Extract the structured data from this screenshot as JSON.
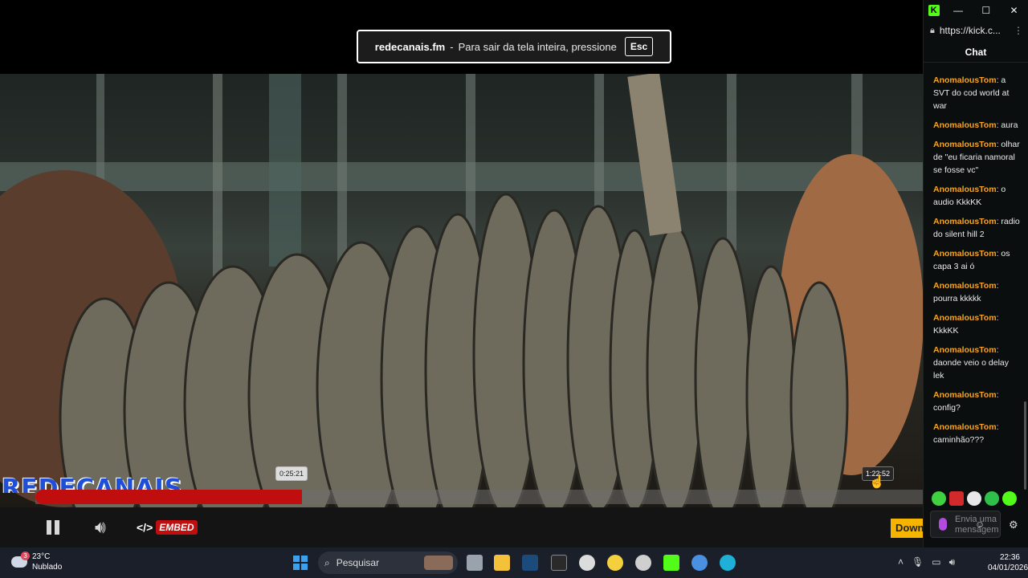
{
  "fullscreen_notice": {
    "site": "redecanais.fm",
    "separator": "-",
    "message": "Para sair da tela inteira, pressione",
    "key": "Esc"
  },
  "player": {
    "logo_text": "REDECANAIS",
    "progress": 0.3,
    "current_time_tip": "0:25:21",
    "hover_time_tip": "1:22:52",
    "embed_label": "EMBED",
    "download_label": "Download"
  },
  "side_panel": {
    "window_buttons": {
      "minimize": "—",
      "maximize": "☐",
      "close": "✕"
    },
    "url": "https://kick.c...",
    "chat_title": "Chat",
    "messages": [
      {
        "user": "AnomalousTom",
        "text": ": a SVT do cod world at war"
      },
      {
        "user": "AnomalousTom",
        "text": ": aura"
      },
      {
        "user": "AnomalousTom",
        "text": ": olhar de \"eu ficaria namoral se fosse vc\""
      },
      {
        "user": "AnomalousTom",
        "text": ": o audio KkkKK"
      },
      {
        "user": "AnomalousTom",
        "text": ": radio do silent hill 2"
      },
      {
        "user": "AnomalousTom",
        "text": ": os capa 3 ai ó"
      },
      {
        "user": "AnomalousTom",
        "text": ": pourra kkkkk"
      },
      {
        "user": "AnomalousTom",
        "text": ": KkkKK"
      },
      {
        "user": "AnomalousTom",
        "text": ": daonde veio o delay lek"
      },
      {
        "user": "AnomalousTom",
        "text": ": config?"
      },
      {
        "user": "AnomalousTom",
        "text": ": caminhão???"
      }
    ],
    "input_placeholder": "Envia uma mensagem"
  },
  "taskbar": {
    "temperature": "23°C",
    "condition": "Nublado",
    "notification_count": "3",
    "search_label": "Pesquisar",
    "time": "22:36",
    "date": "04/01/2026"
  },
  "colors": {
    "accent_red": "#c00d0d",
    "kick_green": "#53fc18",
    "username": "#f3a623"
  }
}
